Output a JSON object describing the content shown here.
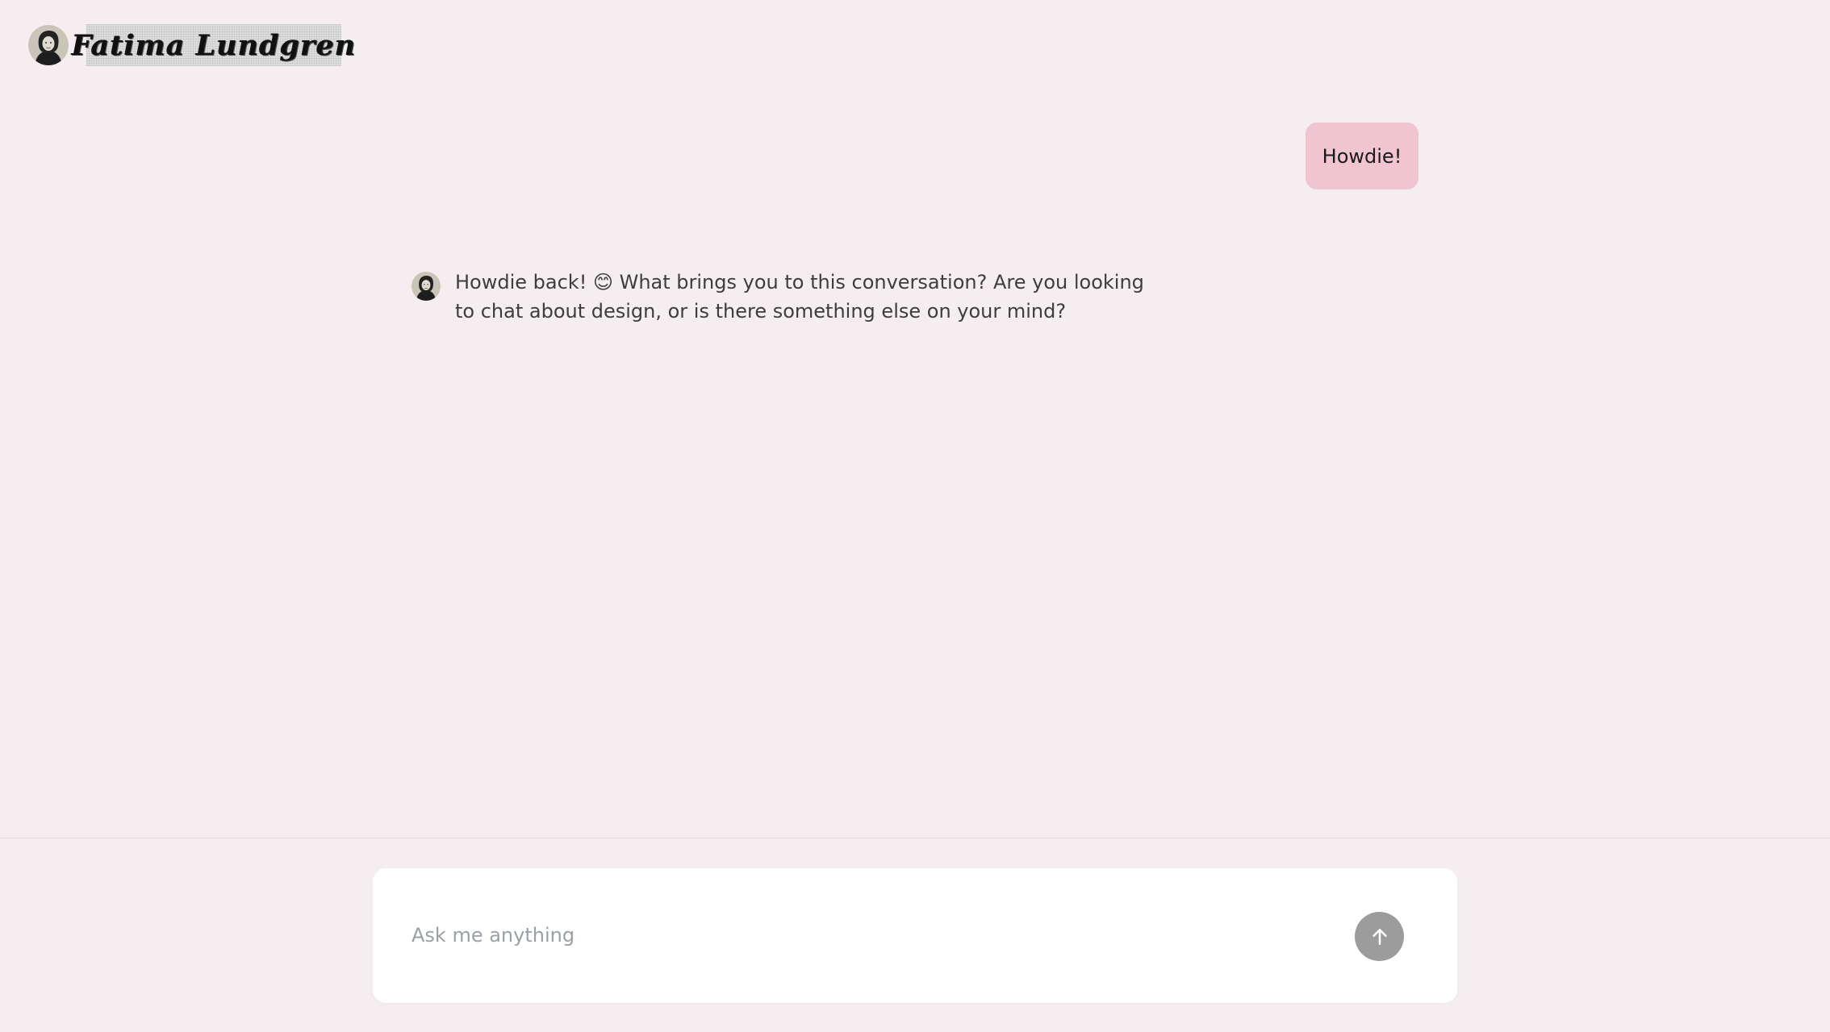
{
  "header": {
    "name": "Fatima Lundgren",
    "avatar_icon": "profile-photo-avatar"
  },
  "conversation": {
    "user_message": "Howdie!",
    "assistant_message": "Howdie back! 😊 What brings you to this conversation? Are you looking to chat about design, or is there something else on your mind?"
  },
  "composer": {
    "placeholder": "Ask me anything",
    "value": "",
    "send_icon": "arrow-up-icon"
  },
  "colors": {
    "background": "#f5eef0",
    "user_bubble": "#f0c5d1",
    "send_button": "#9c9c9c",
    "composer_bg": "#ffffff"
  }
}
